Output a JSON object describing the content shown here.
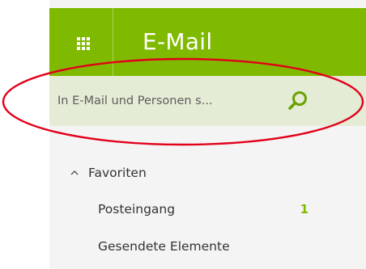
{
  "header": {
    "app_launcher_icon": "waffle-grid-icon",
    "title": "E-Mail",
    "background_color": "#7fba00"
  },
  "search": {
    "placeholder": "In E-Mail und Personen s...",
    "button_icon": "search-magnifier-icon",
    "background_color": "#e4ecd6"
  },
  "favorites": {
    "expanded": true,
    "chevron_icon": "chevron-up-icon",
    "label": "Favoriten",
    "items": [
      {
        "label": "Posteingang",
        "count": "1"
      },
      {
        "label": "Gesendete Elemente",
        "count": ""
      }
    ]
  },
  "annotation": {
    "shape": "ellipse",
    "color": "#e2001a"
  }
}
